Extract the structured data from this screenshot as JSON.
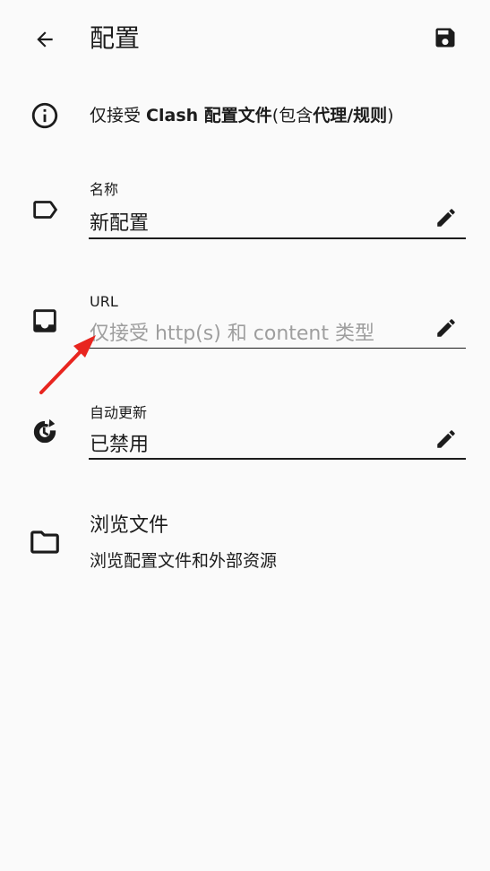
{
  "appbar": {
    "title": "配置",
    "back_icon": "arrow-back-icon",
    "save_icon": "save-icon"
  },
  "info": {
    "icon": "info-icon",
    "prefix": "仅接受 ",
    "clash": "Clash 配置文件",
    "open_paren": "(包含",
    "proxy_rule": "代理/规则",
    "close_paren": ")"
  },
  "fields": {
    "name": {
      "icon": "label-tag-icon",
      "label": "名称",
      "value": "新配置"
    },
    "url": {
      "icon": "inbox-icon",
      "label": "URL",
      "placeholder": "仅接受 http(s) 和 content 类型"
    },
    "auto_update": {
      "icon": "update-clock-icon",
      "label": "自动更新",
      "value": "已禁用"
    }
  },
  "browse": {
    "icon": "folder-icon",
    "title": "浏览文件",
    "subtitle": "浏览配置文件和外部资源"
  },
  "colors": {
    "background": "#fafafa",
    "text": "#1c1c1c",
    "placeholder": "#9e9e9e",
    "annotation_arrow": "#e8251f"
  }
}
